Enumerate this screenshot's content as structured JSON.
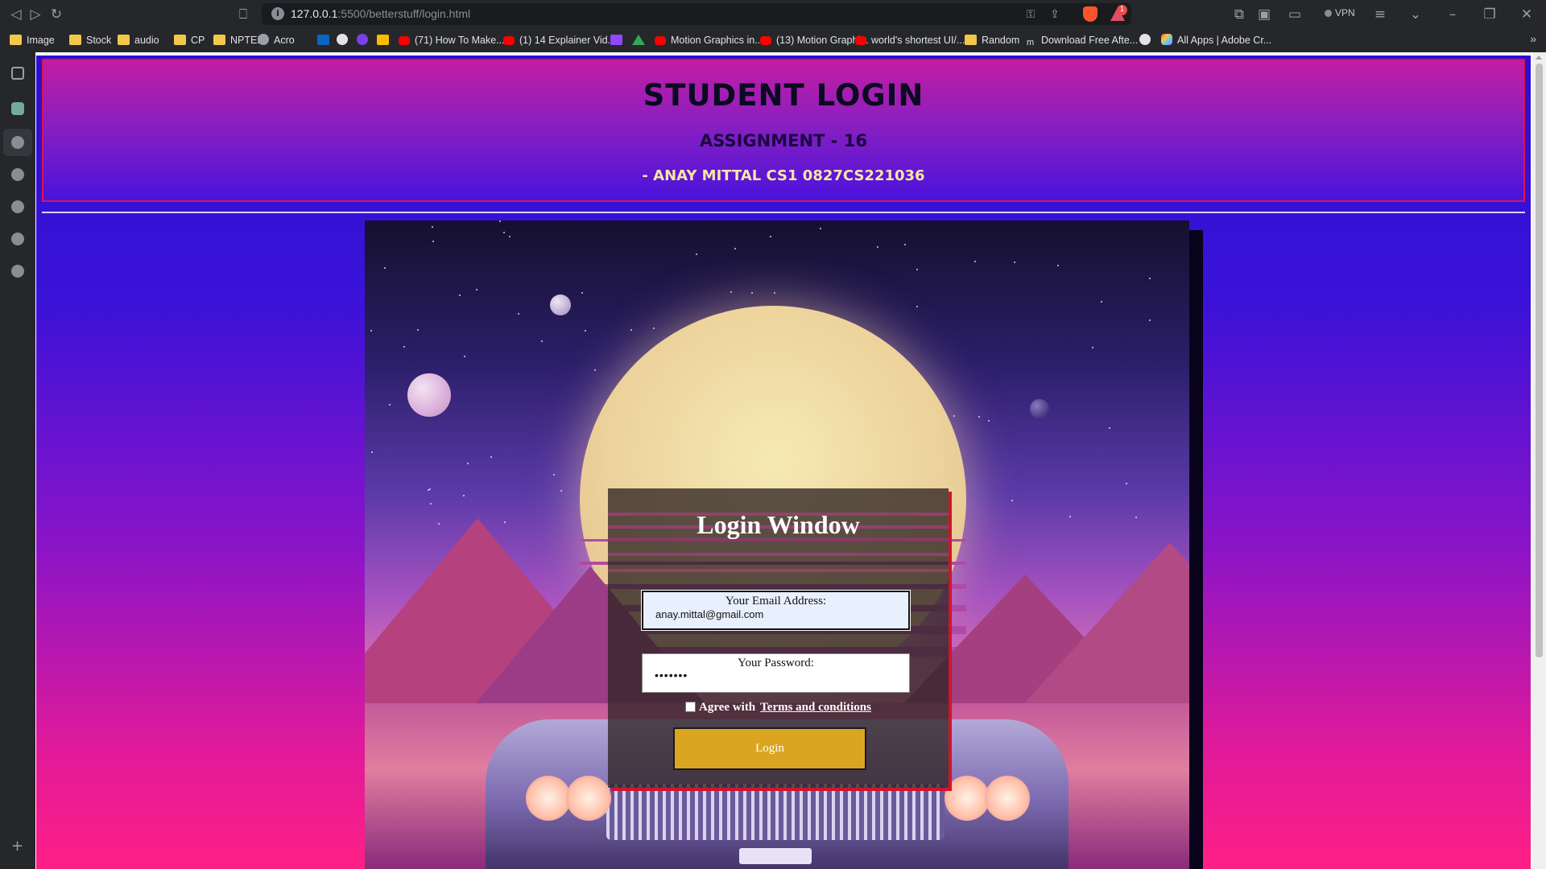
{
  "browser": {
    "url_host": "127.0.0.1",
    "url_path": ":5500/betterstuff/login.html",
    "vpn_label": "VPN",
    "rewards_badge": "1",
    "bookmarks": [
      {
        "label": "Image",
        "icon": "folder-icon"
      },
      {
        "label": "Stock",
        "icon": "folder-icon"
      },
      {
        "label": "audio",
        "icon": "folder-icon"
      },
      {
        "label": "CP",
        "icon": "folder-icon"
      },
      {
        "label": "NPTEL",
        "icon": "folder-icon"
      },
      {
        "label": "Acro",
        "icon": "globe-icon"
      },
      {
        "label": "",
        "icon": "linkedin-icon"
      },
      {
        "label": "",
        "icon": "github-icon"
      },
      {
        "label": "",
        "icon": "purple-app-icon"
      },
      {
        "label": "",
        "icon": "image-app-icon"
      },
      {
        "label": "(71) How To Make...",
        "icon": "youtube-icon"
      },
      {
        "label": "(1) 14 Explainer Vid...",
        "icon": "youtube-icon"
      },
      {
        "label": "",
        "icon": "twitch-icon"
      },
      {
        "label": "",
        "icon": "google-drive-icon"
      },
      {
        "label": "Motion Graphics in...",
        "icon": "youtube-icon"
      },
      {
        "label": "(13) Motion Graphi...",
        "icon": "youtube-icon"
      },
      {
        "label": "world's shortest UI/...",
        "icon": "youtube-icon"
      },
      {
        "label": "Random",
        "icon": "folder-icon"
      },
      {
        "label": "Download Free Afte...",
        "icon": "m-site-icon"
      },
      {
        "label": "",
        "icon": "user-icon"
      },
      {
        "label": "All Apps | Adobe Cr...",
        "icon": "adobe-icon"
      }
    ],
    "more_bookmarks": "»"
  },
  "header": {
    "title": "STUDENT LOGIN",
    "subtitle": "ASSIGNMENT - 16",
    "author": "- ANAY MITTAL CS1 0827CS221036"
  },
  "login": {
    "title": "Login Window",
    "email_label": "Your Email Address:",
    "email_value": "anay.mittal@gmail.com",
    "password_label": "Your Password:",
    "password_value": "•••••••",
    "terms_prefix": "Agree with",
    "terms_link": "Terms and conditions",
    "terms_checked": false,
    "button_label": "Login"
  },
  "colors": {
    "header_border": "#e0114d",
    "button": "#daa520",
    "title_text": "#0a0a20",
    "author_text": "#f5e6a6"
  }
}
